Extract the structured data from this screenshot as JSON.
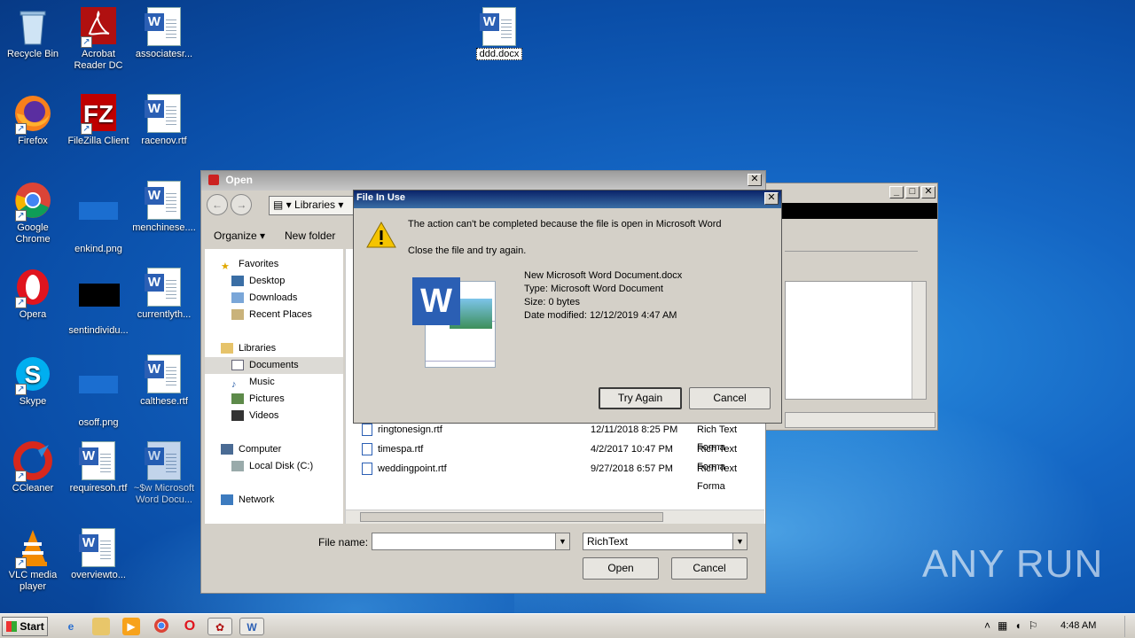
{
  "desktop": {
    "icons": [
      {
        "label": "Recycle Bin"
      },
      {
        "label": "Acrobat Reader DC"
      },
      {
        "label": "associatesr..."
      },
      {
        "label": "Firefox"
      },
      {
        "label": "FileZilla Client"
      },
      {
        "label": "racenov.rtf"
      },
      {
        "label": "Google Chrome"
      },
      {
        "label": "enkind.png"
      },
      {
        "label": "menchinese...."
      },
      {
        "label": "Opera"
      },
      {
        "label": "sentindividu..."
      },
      {
        "label": "currentlyth..."
      },
      {
        "label": "Skype"
      },
      {
        "label": "osoff.png"
      },
      {
        "label": "calthese.rtf"
      },
      {
        "label": "CCleaner"
      },
      {
        "label": "requiresoh.rtf"
      },
      {
        "label": "~$w Microsoft Word Docu..."
      },
      {
        "label": "VLC media player"
      },
      {
        "label": "overviewto..."
      }
    ],
    "selected_icon": {
      "label": "ddd.docx"
    }
  },
  "open_dialog": {
    "title": "Open",
    "breadcrumb": "Libraries",
    "toolbar": {
      "organize": "Organize",
      "new_folder": "New folder"
    },
    "nav": {
      "favorites": "Favorites",
      "desktop": "Desktop",
      "downloads": "Downloads",
      "recent": "Recent Places",
      "libraries": "Libraries",
      "documents": "Documents",
      "music": "Music",
      "pictures": "Pictures",
      "videos": "Videos",
      "computer": "Computer",
      "local_disk": "Local Disk (C:)",
      "network": "Network"
    },
    "files": [
      {
        "name": "ringtonesign.rtf",
        "date": "12/11/2018 8:25 PM",
        "type": "Rich Text Forma"
      },
      {
        "name": "timespa.rtf",
        "date": "4/2/2017 10:47 PM",
        "type": "Rich Text Forma"
      },
      {
        "name": "weddingpoint.rtf",
        "date": "9/27/2018 6:57 PM",
        "type": "Rich Text Forma"
      }
    ],
    "file_name_label": "File name:",
    "file_name_value": "",
    "file_type_value": "RichText",
    "open_button": "Open",
    "cancel_button": "Cancel"
  },
  "file_in_use": {
    "title": "File In Use",
    "message": "The action can't be completed because the file is open in Microsoft Word",
    "instruction": "Close the file and try again.",
    "file_name": "New Microsoft Word Document.docx",
    "file_type": "Type: Microsoft Word Document",
    "file_size": "Size: 0 bytes",
    "file_date": "Date modified: 12/12/2019 4:47 AM",
    "try_again_button": "Try Again",
    "cancel_button": "Cancel"
  },
  "taskbar": {
    "start_label": "Start",
    "clock": "4:48 AM"
  },
  "watermark": "ANY RUN"
}
